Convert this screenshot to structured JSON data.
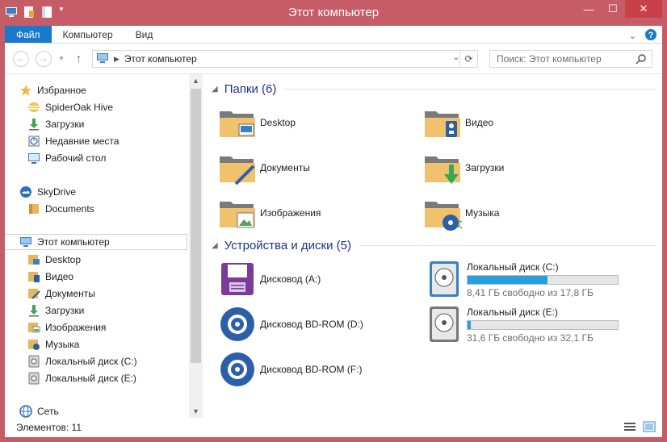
{
  "window": {
    "title": "Этот компьютер"
  },
  "ribbon": {
    "tabs": [
      "Файл",
      "Компьютер",
      "Вид"
    ]
  },
  "address": {
    "path": "Этот компьютер",
    "search_placeholder": "Поиск: Этот компьютер"
  },
  "nav": {
    "favorites": "Избранное",
    "fav_items": [
      "SpiderOak Hive",
      "Загрузки",
      "Недавние места",
      "Рабочий стол"
    ],
    "skydrive": "SkyDrive",
    "sky_items": [
      "Documents"
    ],
    "computer": "Этот компьютер",
    "comp_items": [
      "Desktop",
      "Видео",
      "Документы",
      "Загрузки",
      "Изображения",
      "Музыка",
      "Локальный диск (C:)",
      "Локальный диск (E:)"
    ],
    "network": "Сеть"
  },
  "content": {
    "folders_header": "Папки (6)",
    "folders": [
      "Desktop",
      "Видео",
      "Документы",
      "Загрузки",
      "Изображения",
      "Музыка"
    ],
    "devices_header": "Устройства и диски (5)",
    "devices": [
      "Дисковод (A:)",
      "Дисковод BD-ROM (D:)",
      "Дисковод BD-ROM (F:)"
    ],
    "disks": [
      {
        "name": "Локальный диск (C:)",
        "free": "8,41 ГБ свободно из 17,8 ГБ",
        "used_fraction": 0.53
      },
      {
        "name": "Локальный диск (E:)",
        "free": "31,6 ГБ свободно из 32,1 ГБ",
        "used_fraction": 0.02
      }
    ]
  },
  "status": {
    "items": "Элементов: 11"
  },
  "colors": {
    "frame": "#c55c66",
    "accent": "#1979ca",
    "bar": "#26a0da",
    "group": "#1e3287"
  }
}
